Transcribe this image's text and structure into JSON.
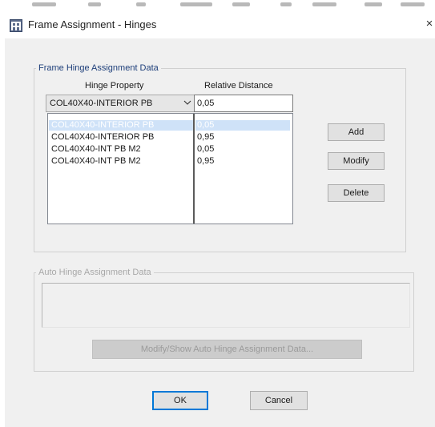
{
  "window": {
    "title": "Frame Assignment - Hinges",
    "close_glyph": "×",
    "app_icon": "structure-app-icon"
  },
  "hinge_group": {
    "legend": "Frame Hinge Assignment Data",
    "col_property": "Hinge Property",
    "col_distance": "Relative Distance",
    "selected_property": "COL40X40-INTERIOR PB",
    "distance_value": "0,05",
    "rows": [
      {
        "property": "COL40X40-INTERIOR PB",
        "distance": "0,05",
        "selected": true
      },
      {
        "property": "COL40X40-INTERIOR PB",
        "distance": "0,95",
        "selected": false
      },
      {
        "property": "COL40X40-INT PB M2",
        "distance": "0,05",
        "selected": false
      },
      {
        "property": "COL40X40-INT PB M2",
        "distance": "0,95",
        "selected": false
      }
    ],
    "buttons": {
      "add": "Add",
      "modify": "Modify",
      "delete": "Delete"
    }
  },
  "auto_group": {
    "legend": "Auto Hinge Assignment Data",
    "button": "Modify/Show Auto Hinge Assignment Data..."
  },
  "footer": {
    "ok": "OK",
    "cancel": "Cancel"
  },
  "colors": {
    "dialog_bg": "#f0f0f0",
    "selection": "#cfe2f8",
    "legend_blue": "#1e3f7a",
    "focus_blue": "#0078d7"
  }
}
